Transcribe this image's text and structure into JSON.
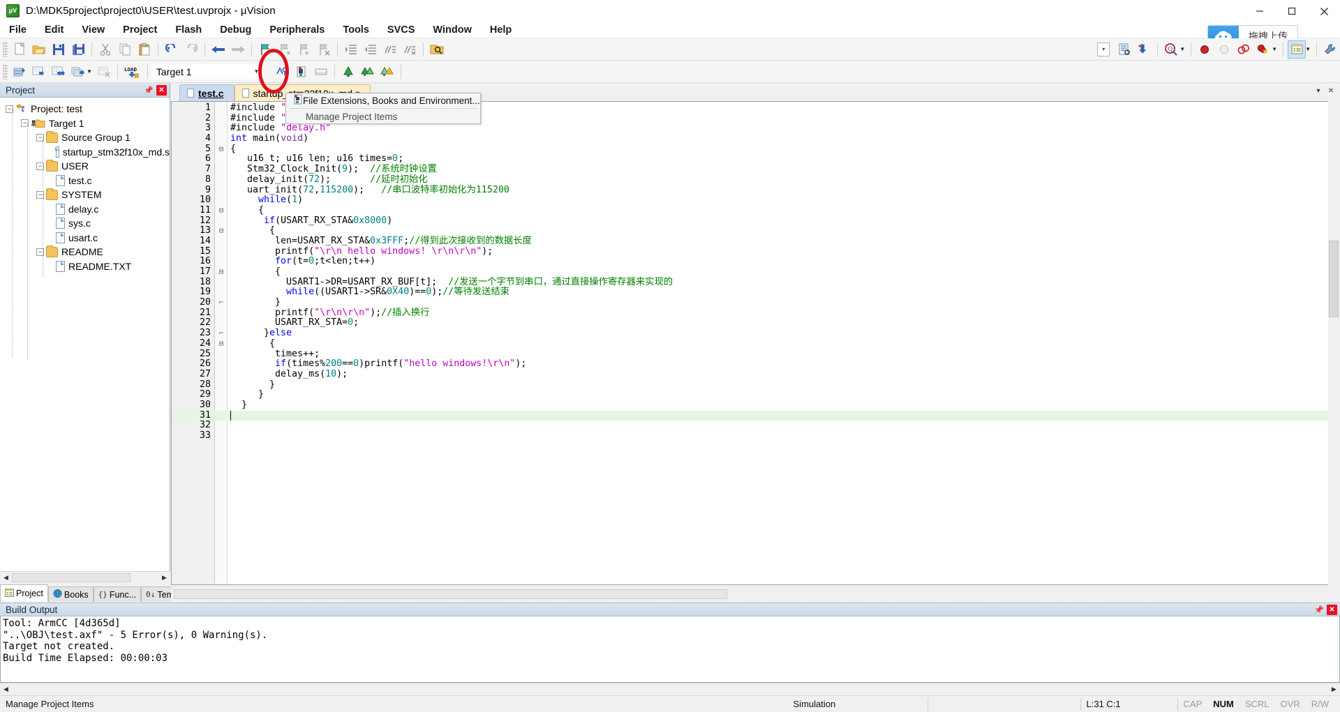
{
  "window": {
    "title": "D:\\MDK5project\\project0\\USER\\test.uvprojx - µVision",
    "app_icon": "uvision-logo-icon",
    "minimize": "minimize-icon",
    "maximize": "maximize-icon",
    "close": "close-icon"
  },
  "menubar": {
    "items": [
      "File",
      "Edit",
      "View",
      "Project",
      "Flash",
      "Debug",
      "Peripherals",
      "Tools",
      "SVCS",
      "Window",
      "Help"
    ]
  },
  "toolbar_main": {
    "buttons": [
      "new-file-icon",
      "open-file-icon",
      "save-icon",
      "save-all-icon",
      "cut-icon",
      "copy-icon",
      "paste-icon",
      "undo-icon",
      "redo-icon",
      "navigate-back-icon",
      "navigate-forward-icon",
      "bookmark-toggle-icon",
      "bookmark-prev-icon",
      "bookmark-next-icon",
      "bookmark-clear-icon",
      "indent-icon",
      "outdent-icon",
      "comment-icon",
      "uncomment-icon",
      "find-in-files-icon"
    ],
    "right_buttons": [
      "combo-dropdown",
      "insert-file-icon",
      "configure-icon",
      "find-icon",
      "find-dropdown-caret",
      "breakpoint-icon",
      "breakpoint-disable-icon",
      "breakpoint-all-icon",
      "breakpoint-kill-icon",
      "breakpoint-caret",
      "project-window-icon",
      "project-window-caret",
      "configure-tools-icon"
    ]
  },
  "toolbar_build": {
    "buttons": [
      "translate-icon",
      "build-icon",
      "rebuild-icon",
      "batch-build-icon",
      "stop-build-icon",
      "load-icon"
    ],
    "target_selector": {
      "value": "Target 1",
      "caret": "chevron-down-icon"
    },
    "right_buttons": [
      "target-options-icon",
      "manage-project-items-icon",
      "manage-run-time-icon",
      "svcs-icon",
      "pack-installer-icon",
      "pack-installer-2-icon"
    ]
  },
  "upload_widget": {
    "icon": "cloud-upload-icon",
    "label": "拖拽上传"
  },
  "project_panel": {
    "header": "Project",
    "pin_icon": "pin-icon",
    "close_icon": "close-icon",
    "tree": [
      {
        "label": "Project: test",
        "depth": 0,
        "kind": "project",
        "expander": "-"
      },
      {
        "label": "Target 1",
        "depth": 1,
        "kind": "target",
        "expander": "-"
      },
      {
        "label": "Source Group 1",
        "depth": 2,
        "kind": "folder",
        "expander": "-"
      },
      {
        "label": "startup_stm32f10x_md.s",
        "depth": 3,
        "kind": "file",
        "expander": ""
      },
      {
        "label": "USER",
        "depth": 2,
        "kind": "folder",
        "expander": "-"
      },
      {
        "label": "test.c",
        "depth": 3,
        "kind": "file",
        "expander": ""
      },
      {
        "label": "SYSTEM",
        "depth": 2,
        "kind": "folder",
        "expander": "-"
      },
      {
        "label": "delay.c",
        "depth": 3,
        "kind": "file",
        "expander": ""
      },
      {
        "label": "sys.c",
        "depth": 3,
        "kind": "file",
        "expander": ""
      },
      {
        "label": "usart.c",
        "depth": 3,
        "kind": "file",
        "expander": ""
      },
      {
        "label": "README",
        "depth": 2,
        "kind": "folder",
        "expander": "-"
      },
      {
        "label": "README.TXT",
        "depth": 3,
        "kind": "file",
        "expander": ""
      }
    ],
    "bottom_tabs": [
      {
        "label": "Project",
        "icon": "project-tab-icon",
        "selected": true
      },
      {
        "label": "Books",
        "icon": "books-tab-icon",
        "selected": false
      },
      {
        "label": "Func...",
        "icon": "functions-tab-icon",
        "selected": false
      },
      {
        "label": "Tem...",
        "icon": "templates-tab-icon",
        "selected": false
      }
    ]
  },
  "editor": {
    "tabs": [
      {
        "label": "test.c",
        "selected": true
      },
      {
        "label": "startup_stm32f10x_md.s",
        "selected": false
      }
    ],
    "minimize_icon": "minimize-icon",
    "close_icon": "close-icon",
    "current_line": 31,
    "lines": [
      {
        "n": 1,
        "fold": "",
        "text": "#include \"sys.h\""
      },
      {
        "n": 2,
        "fold": "",
        "text": "#include \"usart.h\""
      },
      {
        "n": 3,
        "fold": "",
        "text": "#include \"delay.h\""
      },
      {
        "n": 4,
        "fold": "",
        "text": "int main(void)"
      },
      {
        "n": 5,
        "fold": "-",
        "text": "{"
      },
      {
        "n": 6,
        "fold": "",
        "text": "   u16 t; u16 len; u16 times=0;"
      },
      {
        "n": 7,
        "fold": "",
        "text": "   Stm32_Clock_Init(9);  //系统时钟设置"
      },
      {
        "n": 8,
        "fold": "",
        "text": "   delay_init(72);       //延时初始化"
      },
      {
        "n": 9,
        "fold": "",
        "text": "   uart_init(72,115200);   //串口波特率初始化为115200"
      },
      {
        "n": 10,
        "fold": "",
        "text": "     while(1)"
      },
      {
        "n": 11,
        "fold": "-",
        "text": "     {"
      },
      {
        "n": 12,
        "fold": "",
        "text": "      if(USART_RX_STA&0x8000)"
      },
      {
        "n": 13,
        "fold": "-",
        "text": "       {"
      },
      {
        "n": 14,
        "fold": "",
        "text": "        len=USART_RX_STA&0x3FFF;//得到此次接收到的数据长度"
      },
      {
        "n": 15,
        "fold": "",
        "text": "        printf(\"\\r\\n hello windows! \\r\\n\\r\\n\");"
      },
      {
        "n": 16,
        "fold": "",
        "text": "        for(t=0;t<len;t++)"
      },
      {
        "n": 17,
        "fold": "-",
        "text": "        {"
      },
      {
        "n": 18,
        "fold": "",
        "text": "          USART1->DR=USART_RX_BUF[t];  //发送一个字节到串口，通过直接操作寄存器来实现的"
      },
      {
        "n": 19,
        "fold": "",
        "text": "          while((USART1->SR&0X40)==0);//等待发送结束"
      },
      {
        "n": 20,
        "fold": "-",
        "text": "        }"
      },
      {
        "n": 21,
        "fold": "",
        "text": "        printf(\"\\r\\n\\r\\n\");//插入换行"
      },
      {
        "n": 22,
        "fold": "",
        "text": "        USART_RX_STA=0;"
      },
      {
        "n": 23,
        "fold": "-",
        "text": "      }else"
      },
      {
        "n": 24,
        "fold": "-",
        "text": "       {"
      },
      {
        "n": 25,
        "fold": "",
        "text": "        times++;"
      },
      {
        "n": 26,
        "fold": "",
        "text": "        if(times%200==0)printf(\"hello windows!\\r\\n\");"
      },
      {
        "n": 27,
        "fold": "",
        "text": "        delay_ms(10);"
      },
      {
        "n": 28,
        "fold": "",
        "text": "       }"
      },
      {
        "n": 29,
        "fold": "",
        "text": "     }"
      },
      {
        "n": 30,
        "fold": "",
        "text": "  }"
      },
      {
        "n": 31,
        "fold": "",
        "text": ""
      },
      {
        "n": 32,
        "fold": "",
        "text": ""
      },
      {
        "n": 33,
        "fold": "",
        "text": ""
      }
    ]
  },
  "dropdown_menu": {
    "items": [
      {
        "label": "File Extensions, Books and Environment...",
        "icon": "file-extensions-icon",
        "enabled": true
      },
      {
        "label": "Manage Project Items",
        "icon": "",
        "enabled": false
      }
    ]
  },
  "build_output": {
    "header": "Build Output",
    "pin_icon": "pin-icon",
    "close_icon": "close-icon",
    "lines": [
      "Tool: ArmCC [4d365d]",
      "\"..\\OBJ\\test.axf\" - 5 Error(s), 0 Warning(s).",
      "Target not created.",
      "Build Time Elapsed:  00:00:03"
    ]
  },
  "statusbar": {
    "hint": "Manage Project Items",
    "simulation": "Simulation",
    "cursor": "L:31 C:1",
    "indicators": [
      {
        "label": "CAP",
        "active": false
      },
      {
        "label": "NUM",
        "active": true
      },
      {
        "label": "SCRL",
        "active": false
      },
      {
        "label": "OVR",
        "active": false
      },
      {
        "label": "R/W",
        "active": false
      }
    ]
  },
  "colors": {
    "accent": "#2b8cd9",
    "annotation": "#e01020",
    "keyword": "#0000ff",
    "comment": "#008000",
    "string": "#bf00bf",
    "number": "#008080",
    "current_line": "#e7f5e7"
  }
}
